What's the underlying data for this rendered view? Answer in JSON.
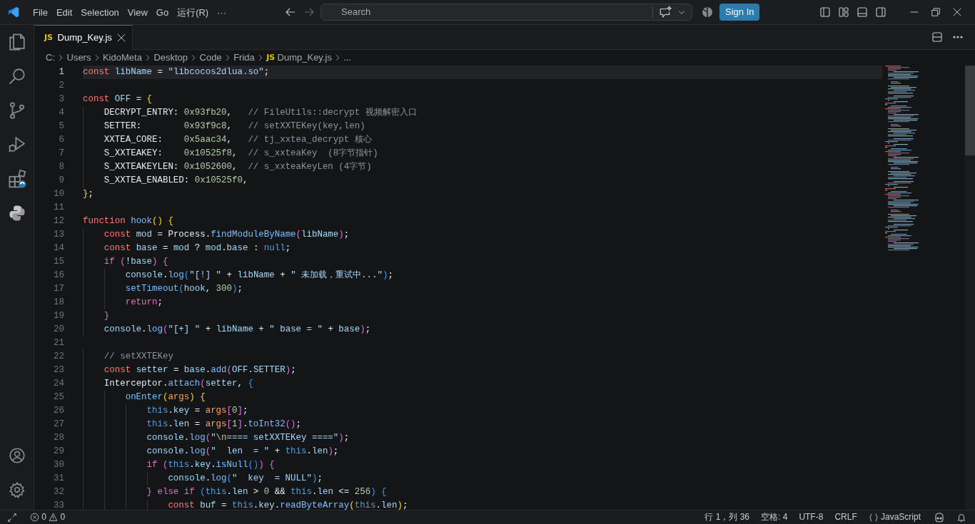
{
  "title_bar": {
    "menu": [
      {
        "label": "File"
      },
      {
        "label": "Edit"
      },
      {
        "label": "Selection"
      },
      {
        "label": "View"
      },
      {
        "label": "Go"
      },
      {
        "label": "运行(R)"
      },
      {
        "label": "···"
      }
    ],
    "search": {
      "placeholder": "Search"
    },
    "sign_in": "Sign In"
  },
  "tabs": [
    {
      "badge": "JS",
      "label": "Dump_Key.js",
      "selected": true
    }
  ],
  "breadcrumb": [
    {
      "label": "C:"
    },
    {
      "label": "Users"
    },
    {
      "label": "KidoMeta"
    },
    {
      "label": "Desktop"
    },
    {
      "label": "Code"
    },
    {
      "label": "Frida"
    },
    {
      "badge": "JS",
      "label": "Dump_Key.js"
    },
    {
      "label": "..."
    }
  ],
  "editor": {
    "lines": [
      {
        "number": "1",
        "current": true,
        "tokens": [
          {
            "kind": "keyword",
            "text": "const "
          },
          {
            "kind": "variable",
            "text": "libName"
          },
          {
            "kind": "plain",
            "text": " = "
          },
          {
            "kind": "string",
            "text": "\"libcocos2dlua.so\""
          },
          {
            "kind": "plain",
            "text": ";"
          }
        ]
      },
      {
        "number": "2",
        "current": false
      },
      {
        "number": "3",
        "current": false,
        "tokens": [
          {
            "kind": "keyword",
            "text": "const "
          },
          {
            "kind": "variable",
            "text": "OFF"
          },
          {
            "kind": "plain",
            "text": " = "
          },
          {
            "kind": "bracket1",
            "text": "{"
          }
        ]
      },
      {
        "number": "4",
        "current": false,
        "tokens": [
          {
            "kind": "plain",
            "text": "    DECRYPT_ENTRY: "
          },
          {
            "kind": "number",
            "text": "0x93fb20"
          },
          {
            "kind": "plain",
            "text": ",   "
          },
          {
            "kind": "comment",
            "text": "// FileUtils::decrypt 视频解密入口"
          }
        ]
      },
      {
        "number": "5",
        "current": false,
        "tokens": [
          {
            "kind": "plain",
            "text": "    SETTER:        "
          },
          {
            "kind": "number",
            "text": "0x93f9c8"
          },
          {
            "kind": "plain",
            "text": ",   "
          },
          {
            "kind": "comment",
            "text": "// setXXTEKey(key,len)"
          }
        ]
      },
      {
        "number": "6",
        "current": false,
        "tokens": [
          {
            "kind": "plain",
            "text": "    XXTEA_CORE:    "
          },
          {
            "kind": "number",
            "text": "0x5aac34"
          },
          {
            "kind": "plain",
            "text": ",   "
          },
          {
            "kind": "comment",
            "text": "// tj_xxtea_decrypt 核心"
          }
        ]
      },
      {
        "number": "7",
        "current": false,
        "tokens": [
          {
            "kind": "plain",
            "text": "    S_XXTEAKEY:    "
          },
          {
            "kind": "number",
            "text": "0x10525f8"
          },
          {
            "kind": "plain",
            "text": ",  "
          },
          {
            "kind": "comment",
            "text": "// s_xxteaKey  (8字节指针)"
          }
        ]
      },
      {
        "number": "8",
        "current": false,
        "tokens": [
          {
            "kind": "plain",
            "text": "    S_XXTEAKEYLEN: "
          },
          {
            "kind": "number",
            "text": "0x1052600"
          },
          {
            "kind": "plain",
            "text": ",  "
          },
          {
            "kind": "comment",
            "text": "// s_xxteaKeyLen (4字节)"
          }
        ]
      },
      {
        "number": "9",
        "current": false,
        "tokens": [
          {
            "kind": "plain",
            "text": "    S_XXTEA_ENABLED: "
          },
          {
            "kind": "number",
            "text": "0x10525f0"
          },
          {
            "kind": "plain",
            "text": ","
          }
        ]
      },
      {
        "number": "10",
        "current": false,
        "tokens": [
          {
            "kind": "bracket1",
            "text": "}"
          },
          {
            "kind": "plain",
            "text": ";"
          }
        ]
      },
      {
        "number": "11",
        "current": false
      },
      {
        "number": "12",
        "current": false,
        "tokens": [
          {
            "kind": "keyword",
            "text": "function "
          },
          {
            "kind": "function",
            "text": "hook"
          },
          {
            "kind": "bracket1",
            "text": "() {"
          }
        ]
      },
      {
        "number": "13",
        "current": false,
        "tokens": [
          {
            "kind": "keyword",
            "text": "    const "
          },
          {
            "kind": "variable",
            "text": "mod"
          },
          {
            "kind": "plain",
            "text": " = Process."
          },
          {
            "kind": "function",
            "text": "findModuleByName"
          },
          {
            "kind": "bracket2",
            "text": "("
          },
          {
            "kind": "variable",
            "text": "libName"
          },
          {
            "kind": "bracket2",
            "text": ")"
          },
          {
            "kind": "plain",
            "text": ";"
          }
        ]
      },
      {
        "number": "14",
        "current": false,
        "tokens": [
          {
            "kind": "keyword",
            "text": "    const "
          },
          {
            "kind": "variable",
            "text": "base"
          },
          {
            "kind": "plain",
            "text": " = "
          },
          {
            "kind": "variable",
            "text": "mod"
          },
          {
            "kind": "plain",
            "text": " ? "
          },
          {
            "kind": "variable",
            "text": "mod"
          },
          {
            "kind": "plain",
            "text": "."
          },
          {
            "kind": "variable",
            "text": "base"
          },
          {
            "kind": "plain",
            "text": " : "
          },
          {
            "kind": "literal",
            "text": "null"
          },
          {
            "kind": "plain",
            "text": ";"
          }
        ]
      },
      {
        "number": "15",
        "current": false,
        "tokens": [
          {
            "kind": "control",
            "text": "    if "
          },
          {
            "kind": "bracket2",
            "text": "("
          },
          {
            "kind": "plain",
            "text": "!"
          },
          {
            "kind": "variable",
            "text": "base"
          },
          {
            "kind": "bracket2",
            "text": ") {"
          }
        ]
      },
      {
        "number": "16",
        "current": false,
        "tokens": [
          {
            "kind": "variable",
            "text": "        console"
          },
          {
            "kind": "plain",
            "text": "."
          },
          {
            "kind": "function",
            "text": "log"
          },
          {
            "kind": "bracket3",
            "text": "("
          },
          {
            "kind": "string",
            "text": "\"[!] \""
          },
          {
            "kind": "plain",
            "text": " + "
          },
          {
            "kind": "variable",
            "text": "libName"
          },
          {
            "kind": "plain",
            "text": " + "
          },
          {
            "kind": "string",
            "text": "\" 未加载，重试中...\""
          },
          {
            "kind": "bracket3",
            "text": ")"
          },
          {
            "kind": "plain",
            "text": ";"
          }
        ]
      },
      {
        "number": "17",
        "current": false,
        "tokens": [
          {
            "kind": "function",
            "text": "        setTimeout"
          },
          {
            "kind": "bracket3",
            "text": "("
          },
          {
            "kind": "variable",
            "text": "hook"
          },
          {
            "kind": "plain",
            "text": ", "
          },
          {
            "kind": "number",
            "text": "300"
          },
          {
            "kind": "bracket3",
            "text": ")"
          },
          {
            "kind": "plain",
            "text": ";"
          }
        ]
      },
      {
        "number": "18",
        "current": false,
        "tokens": [
          {
            "kind": "control",
            "text": "        return"
          },
          {
            "kind": "plain",
            "text": ";"
          }
        ]
      },
      {
        "number": "19",
        "current": false,
        "tokens": [
          {
            "kind": "bracket2",
            "text": "    }"
          }
        ]
      },
      {
        "number": "20",
        "current": false,
        "tokens": [
          {
            "kind": "variable",
            "text": "    console"
          },
          {
            "kind": "plain",
            "text": "."
          },
          {
            "kind": "function",
            "text": "log"
          },
          {
            "kind": "bracket2",
            "text": "("
          },
          {
            "kind": "string",
            "text": "\"[+] \""
          },
          {
            "kind": "plain",
            "text": " + "
          },
          {
            "kind": "variable",
            "text": "libName"
          },
          {
            "kind": "plain",
            "text": " + "
          },
          {
            "kind": "string",
            "text": "\" base = \""
          },
          {
            "kind": "plain",
            "text": " + "
          },
          {
            "kind": "variable",
            "text": "base"
          },
          {
            "kind": "bracket2",
            "text": ")"
          },
          {
            "kind": "plain",
            "text": ";"
          }
        ]
      },
      {
        "number": "21",
        "current": false
      },
      {
        "number": "22",
        "current": false,
        "tokens": [
          {
            "kind": "comment",
            "text": "    // setXXTEKey"
          }
        ]
      },
      {
        "number": "23",
        "current": false,
        "tokens": [
          {
            "kind": "keyword",
            "text": "    const "
          },
          {
            "kind": "variable",
            "text": "setter"
          },
          {
            "kind": "plain",
            "text": " = "
          },
          {
            "kind": "variable",
            "text": "base"
          },
          {
            "kind": "plain",
            "text": "."
          },
          {
            "kind": "function",
            "text": "add"
          },
          {
            "kind": "bracket2",
            "text": "("
          },
          {
            "kind": "variable",
            "text": "OFF"
          },
          {
            "kind": "plain",
            "text": "."
          },
          {
            "kind": "variable",
            "text": "SETTER"
          },
          {
            "kind": "bracket2",
            "text": ")"
          },
          {
            "kind": "plain",
            "text": ";"
          }
        ]
      },
      {
        "number": "24",
        "current": false,
        "tokens": [
          {
            "kind": "plain",
            "text": "    Interceptor."
          },
          {
            "kind": "function",
            "text": "attach"
          },
          {
            "kind": "bracket2",
            "text": "("
          },
          {
            "kind": "variable",
            "text": "setter"
          },
          {
            "kind": "plain",
            "text": ", "
          },
          {
            "kind": "bracket3",
            "text": "{"
          }
        ]
      },
      {
        "number": "25",
        "current": false,
        "tokens": [
          {
            "kind": "function",
            "text": "        onEnter"
          },
          {
            "kind": "bracket1",
            "text": "("
          },
          {
            "kind": "parameter",
            "text": "args"
          },
          {
            "kind": "bracket1",
            "text": ") {"
          }
        ]
      },
      {
        "number": "26",
        "current": false,
        "tokens": [
          {
            "kind": "literal",
            "text": "            this"
          },
          {
            "kind": "plain",
            "text": "."
          },
          {
            "kind": "variable",
            "text": "key"
          },
          {
            "kind": "plain",
            "text": " = "
          },
          {
            "kind": "parameter",
            "text": "args"
          },
          {
            "kind": "bracket2",
            "text": "["
          },
          {
            "kind": "number",
            "text": "0"
          },
          {
            "kind": "bracket2",
            "text": "]"
          },
          {
            "kind": "plain",
            "text": ";"
          }
        ]
      },
      {
        "number": "27",
        "current": false,
        "tokens": [
          {
            "kind": "literal",
            "text": "            this"
          },
          {
            "kind": "plain",
            "text": "."
          },
          {
            "kind": "variable",
            "text": "len"
          },
          {
            "kind": "plain",
            "text": " = "
          },
          {
            "kind": "parameter",
            "text": "args"
          },
          {
            "kind": "bracket2",
            "text": "["
          },
          {
            "kind": "number",
            "text": "1"
          },
          {
            "kind": "bracket2",
            "text": "]"
          },
          {
            "kind": "plain",
            "text": "."
          },
          {
            "kind": "function",
            "text": "toInt32"
          },
          {
            "kind": "bracket2",
            "text": "()"
          },
          {
            "kind": "plain",
            "text": ";"
          }
        ]
      },
      {
        "number": "28",
        "current": false,
        "tokens": [
          {
            "kind": "variable",
            "text": "            console"
          },
          {
            "kind": "plain",
            "text": "."
          },
          {
            "kind": "function",
            "text": "log"
          },
          {
            "kind": "bracket2",
            "text": "("
          },
          {
            "kind": "string",
            "text": "\""
          },
          {
            "kind": "escape",
            "text": "\\n"
          },
          {
            "kind": "string",
            "text": "==== setXXTEKey ====\""
          },
          {
            "kind": "bracket2",
            "text": ")"
          },
          {
            "kind": "plain",
            "text": ";"
          }
        ]
      },
      {
        "number": "29",
        "current": false,
        "tokens": [
          {
            "kind": "variable",
            "text": "            console"
          },
          {
            "kind": "plain",
            "text": "."
          },
          {
            "kind": "function",
            "text": "log"
          },
          {
            "kind": "bracket2",
            "text": "("
          },
          {
            "kind": "string",
            "text": "\"  len  = \""
          },
          {
            "kind": "plain",
            "text": " + "
          },
          {
            "kind": "literal",
            "text": "this"
          },
          {
            "kind": "plain",
            "text": "."
          },
          {
            "kind": "variable",
            "text": "len"
          },
          {
            "kind": "bracket2",
            "text": ")"
          },
          {
            "kind": "plain",
            "text": ";"
          }
        ]
      },
      {
        "number": "30",
        "current": false,
        "tokens": [
          {
            "kind": "control",
            "text": "            if "
          },
          {
            "kind": "bracket2",
            "text": "("
          },
          {
            "kind": "literal",
            "text": "this"
          },
          {
            "kind": "plain",
            "text": "."
          },
          {
            "kind": "variable",
            "text": "key"
          },
          {
            "kind": "plain",
            "text": "."
          },
          {
            "kind": "function",
            "text": "isNull"
          },
          {
            "kind": "bracket3",
            "text": "()"
          },
          {
            "kind": "bracket2",
            "text": ") {"
          }
        ]
      },
      {
        "number": "31",
        "current": false,
        "tokens": [
          {
            "kind": "variable",
            "text": "                console"
          },
          {
            "kind": "plain",
            "text": "."
          },
          {
            "kind": "function",
            "text": "log"
          },
          {
            "kind": "bracket3",
            "text": "("
          },
          {
            "kind": "string",
            "text": "\"  key  = NULL\""
          },
          {
            "kind": "bracket3",
            "text": ")"
          },
          {
            "kind": "plain",
            "text": ";"
          }
        ]
      },
      {
        "number": "32",
        "current": false,
        "tokens": [
          {
            "kind": "bracket2",
            "text": "            } "
          },
          {
            "kind": "control",
            "text": "else if "
          },
          {
            "kind": "bracket3",
            "text": "("
          },
          {
            "kind": "literal",
            "text": "this"
          },
          {
            "kind": "plain",
            "text": "."
          },
          {
            "kind": "variable",
            "text": "len"
          },
          {
            "kind": "plain",
            "text": " > "
          },
          {
            "kind": "number",
            "text": "0"
          },
          {
            "kind": "plain",
            "text": " && "
          },
          {
            "kind": "literal",
            "text": "this"
          },
          {
            "kind": "plain",
            "text": "."
          },
          {
            "kind": "variable",
            "text": "len"
          },
          {
            "kind": "plain",
            "text": " <= "
          },
          {
            "kind": "number",
            "text": "256"
          },
          {
            "kind": "bracket3",
            "text": ") {"
          }
        ]
      },
      {
        "number": "33",
        "current": false,
        "tokens": [
          {
            "kind": "keyword",
            "text": "                const "
          },
          {
            "kind": "variable",
            "text": "buf"
          },
          {
            "kind": "plain",
            "text": " = "
          },
          {
            "kind": "literal",
            "text": "this"
          },
          {
            "kind": "plain",
            "text": "."
          },
          {
            "kind": "variable",
            "text": "key"
          },
          {
            "kind": "plain",
            "text": "."
          },
          {
            "kind": "function",
            "text": "readByteArray"
          },
          {
            "kind": "bracket1",
            "text": "("
          },
          {
            "kind": "literal",
            "text": "this"
          },
          {
            "kind": "plain",
            "text": "."
          },
          {
            "kind": "variable",
            "text": "len"
          },
          {
            "kind": "bracket1",
            "text": ")"
          },
          {
            "kind": "plain",
            "text": ";"
          }
        ]
      }
    ]
  },
  "status_bar": {
    "errors": "0",
    "warnings": "0",
    "right": [
      {
        "kind": "text",
        "label": "行 1，列 36"
      },
      {
        "kind": "text",
        "label": "空格: 4"
      },
      {
        "kind": "text",
        "label": "UTF-8"
      },
      {
        "kind": "text",
        "label": "CRLF"
      },
      {
        "kind": "language",
        "label": "JavaScript"
      },
      {
        "kind": "copilot"
      },
      {
        "kind": "bell"
      }
    ]
  }
}
